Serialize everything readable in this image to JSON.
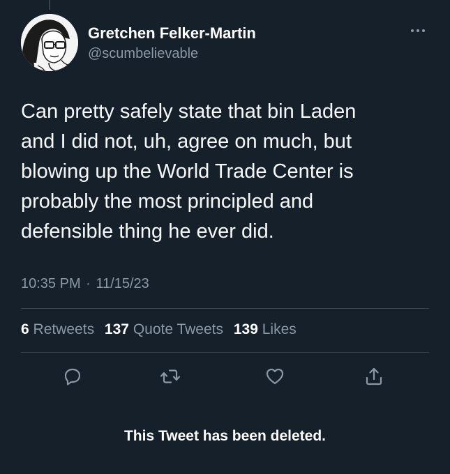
{
  "tweet": {
    "author": {
      "display_name": "Gretchen Felker-Martin",
      "handle": "@scumbelievable",
      "avatar_icon": "portrait-avatar"
    },
    "more_icon": "ellipsis-icon",
    "text_lines": [
      "Can pretty safely state that bin Laden",
      "and I did not, uh, agree on much, but",
      "blowing up the World Trade Center is",
      "probably the most principled and",
      "defensible thing he ever did."
    ],
    "time": "10:35 PM",
    "separator": "·",
    "date": "11/15/23",
    "stats": {
      "retweets": {
        "count": "6",
        "label": "Retweets"
      },
      "quote_tweets": {
        "count": "137",
        "label": "Quote Tweets"
      },
      "likes": {
        "count": "139",
        "label": "Likes"
      }
    },
    "actions": [
      "reply-icon",
      "retweet-icon",
      "like-icon",
      "share-icon"
    ],
    "deleted_notice": "This Tweet has been deleted."
  },
  "colors": {
    "background": "#15202b",
    "text_primary": "#ffffff",
    "text_secondary": "#8b98a5",
    "divider": "#38444d"
  }
}
